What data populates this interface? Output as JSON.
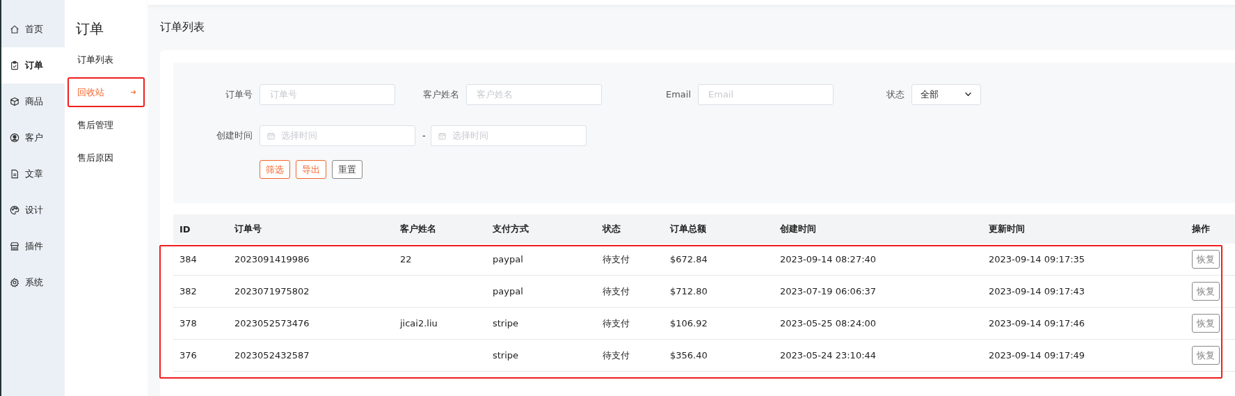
{
  "nav": [
    {
      "label": "首页",
      "selected": false
    },
    {
      "label": "订单",
      "selected": true
    },
    {
      "label": "商品",
      "selected": false
    },
    {
      "label": "客户",
      "selected": false
    },
    {
      "label": "文章",
      "selected": false
    },
    {
      "label": "设计",
      "selected": false
    },
    {
      "label": "插件",
      "selected": false
    },
    {
      "label": "系统",
      "selected": false
    }
  ],
  "subnav": {
    "title": "订单",
    "items": [
      {
        "label": "订单列表",
        "selected": false,
        "highlighted": false
      },
      {
        "label": "回收站",
        "selected": true,
        "highlighted": true
      },
      {
        "label": "售后管理",
        "selected": false,
        "highlighted": false
      },
      {
        "label": "售后原因",
        "selected": false,
        "highlighted": false
      }
    ]
  },
  "page_title": "订单列表",
  "filters": {
    "fields": [
      {
        "kind": "text",
        "label": "订单号",
        "placeholder": "订单号"
      },
      {
        "kind": "text",
        "label": "客户姓名",
        "placeholder": "客户姓名"
      },
      {
        "kind": "text",
        "label": "Email",
        "placeholder": "Email"
      },
      {
        "kind": "select",
        "label": "状态",
        "value": "全部"
      }
    ],
    "date_range": {
      "label": "创建时间",
      "start_placeholder": "选择时间",
      "separator": "-",
      "end_placeholder": "选择时间"
    },
    "buttons": [
      {
        "label": "筛选",
        "kind": "primary"
      },
      {
        "label": "导出",
        "kind": "primary"
      },
      {
        "label": "重置",
        "kind": "default"
      }
    ]
  },
  "table": {
    "highlighted": true,
    "columns": [
      "ID",
      "订单号",
      "客户姓名",
      "支付方式",
      "状态",
      "订单总额",
      "创建时间",
      "更新时间",
      "操作"
    ],
    "rows": [
      {
        "cells": [
          "384",
          "2023091419986",
          "22",
          "paypal",
          "待支付",
          "$672.84",
          "2023-09-14 08:27:40",
          "2023-09-14 09:17:35"
        ],
        "action": "恢复"
      },
      {
        "cells": [
          "382",
          "2023071975802",
          "",
          "paypal",
          "待支付",
          "$712.80",
          "2023-07-19 06:06:37",
          "2023-09-14 09:17:43"
        ],
        "action": "恢复"
      },
      {
        "cells": [
          "378",
          "2023052573476",
          "jicai2.liu",
          "stripe",
          "待支付",
          "$106.92",
          "2023-05-25 08:24:00",
          "2023-09-14 09:17:46"
        ],
        "action": "恢复"
      },
      {
        "cells": [
          "376",
          "2023052432587",
          "",
          "stripe",
          "待支付",
          "$356.40",
          "2023-05-24 23:10:44",
          "2023-09-14 09:17:49"
        ],
        "action": "恢复"
      }
    ]
  }
}
